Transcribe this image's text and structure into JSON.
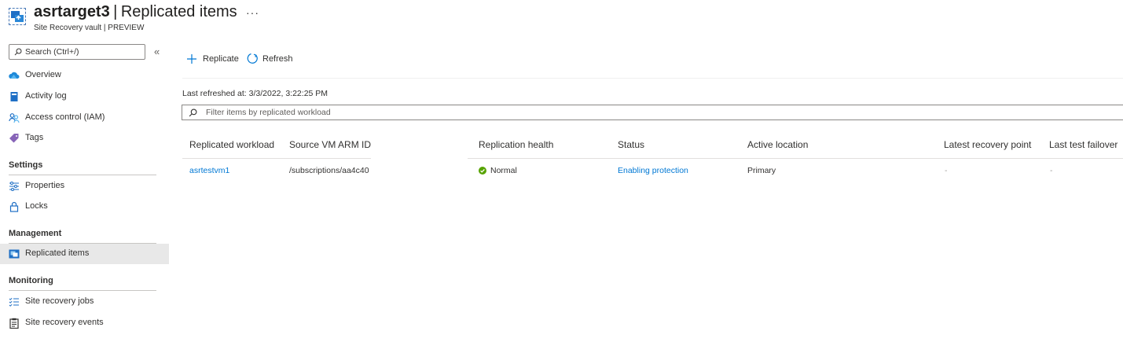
{
  "header": {
    "resource_name": "asrtarget3",
    "separator": "|",
    "page_title": "Replicated items",
    "more_label": "···",
    "subtitle": "Site Recovery vault | PREVIEW"
  },
  "sidebar": {
    "search_placeholder": "Search (Ctrl+/)",
    "collapse_label": "«",
    "items": [
      {
        "label": "Overview",
        "icon": "cloud-icon"
      },
      {
        "label": "Activity log",
        "icon": "book-icon"
      },
      {
        "label": "Access control (IAM)",
        "icon": "people-icon"
      },
      {
        "label": "Tags",
        "icon": "tag-icon"
      }
    ],
    "sections": [
      {
        "title": "Settings",
        "items": [
          {
            "label": "Properties",
            "icon": "sliders-icon"
          },
          {
            "label": "Locks",
            "icon": "lock-icon"
          }
        ]
      },
      {
        "title": "Management",
        "items": [
          {
            "label": "Replicated items",
            "icon": "replicated-items-icon",
            "selected": true
          }
        ]
      },
      {
        "title": "Monitoring",
        "items": [
          {
            "label": "Site recovery jobs",
            "icon": "jobs-list-icon"
          },
          {
            "label": "Site recovery events",
            "icon": "clipboard-icon"
          }
        ]
      }
    ]
  },
  "toolbar": {
    "replicate_label": "Replicate",
    "refresh_label": "Refresh"
  },
  "main": {
    "last_refreshed": "Last refreshed at: 3/3/2022, 3:22:25 PM",
    "filter_placeholder": "Filter items by replicated workload",
    "columns": [
      "Replicated workload",
      "Source VM ARM ID",
      "Replication health",
      "Status",
      "Active location",
      "Latest recovery point",
      "Last test failover"
    ],
    "rows": [
      {
        "workload": "asrtestvm1",
        "source_id": "/subscriptions/aa4c40",
        "health": "Normal",
        "status": "Enabling protection",
        "active_location": "Primary",
        "latest_recovery_point": "-",
        "last_test_failover": "-"
      }
    ]
  },
  "colors": {
    "accent": "#0078d4",
    "healthy": "#57a300",
    "selected_bg": "#e8e8e8"
  }
}
